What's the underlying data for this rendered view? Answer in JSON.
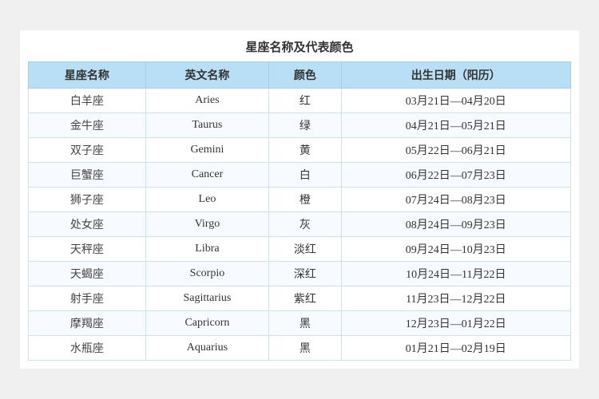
{
  "title": "星座名称及代表颜色",
  "headers": [
    "星座名称",
    "英文名称",
    "颜色",
    "出生日期（阳历）"
  ],
  "rows": [
    {
      "zh": "白羊座",
      "en": "Aries",
      "color": "红",
      "date": "03月21日—04月20日"
    },
    {
      "zh": "金牛座",
      "en": "Taurus",
      "color": "绿",
      "date": "04月21日—05月21日"
    },
    {
      "zh": "双子座",
      "en": "Gemini",
      "color": "黄",
      "date": "05月22日—06月21日"
    },
    {
      "zh": "巨蟹座",
      "en": "Cancer",
      "color": "白",
      "date": "06月22日—07月23日"
    },
    {
      "zh": "狮子座",
      "en": "Leo",
      "color": "橙",
      "date": "07月24日—08月23日"
    },
    {
      "zh": "处女座",
      "en": "Virgo",
      "color": "灰",
      "date": "08月24日—09月23日"
    },
    {
      "zh": "天秤座",
      "en": "Libra",
      "color": "淡红",
      "date": "09月24日—10月23日"
    },
    {
      "zh": "天蝎座",
      "en": "Scorpio",
      "color": "深红",
      "date": "10月24日—11月22日"
    },
    {
      "zh": "射手座",
      "en": "Sagittarius",
      "color": "紫红",
      "date": "11月23日—12月22日"
    },
    {
      "zh": "摩羯座",
      "en": "Capricorn",
      "color": "黑",
      "date": "12月23日—01月22日"
    },
    {
      "zh": "水瓶座",
      "en": "Aquarius",
      "color": "黑",
      "date": "01月21日—02月19日"
    }
  ]
}
